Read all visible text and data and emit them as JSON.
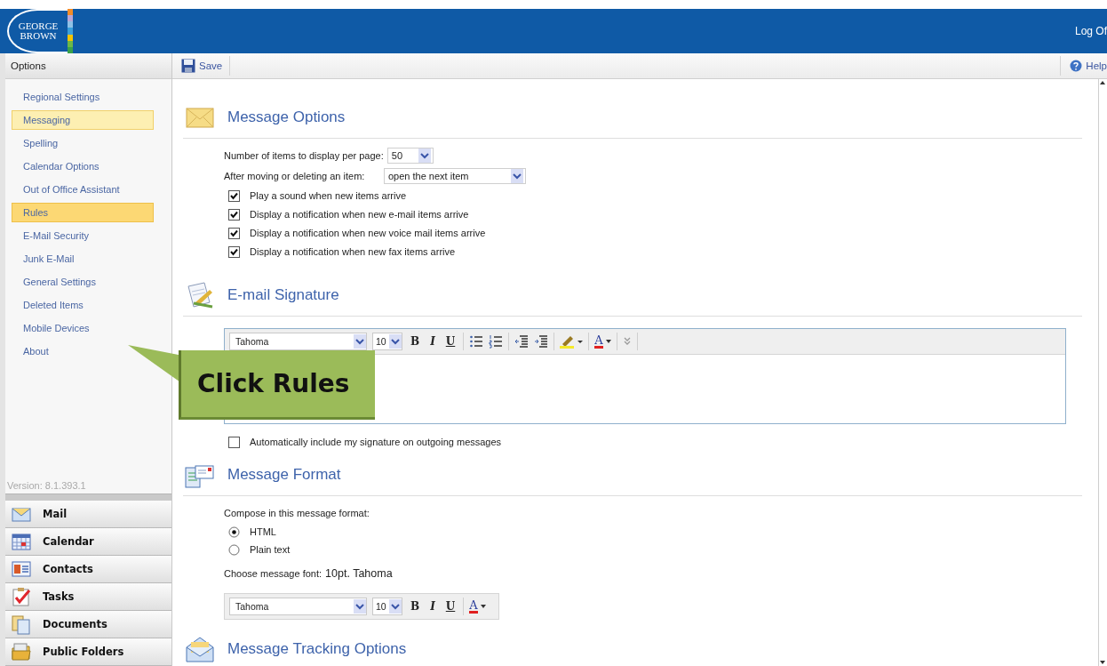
{
  "header": {
    "logo": [
      "GEORGE",
      "BROWN"
    ],
    "logoff": "Log Of"
  },
  "sidebar": {
    "title": "Options",
    "items": [
      {
        "label": "Regional Settings",
        "selected": false,
        "hovered": false
      },
      {
        "label": "Messaging",
        "selected": true,
        "hovered": false
      },
      {
        "label": "Spelling",
        "selected": false,
        "hovered": false
      },
      {
        "label": "Calendar Options",
        "selected": false,
        "hovered": false
      },
      {
        "label": "Out of Office Assistant",
        "selected": false,
        "hovered": false
      },
      {
        "label": "Rules",
        "selected": false,
        "hovered": true
      },
      {
        "label": "E-Mail Security",
        "selected": false,
        "hovered": false
      },
      {
        "label": "Junk E-Mail",
        "selected": false,
        "hovered": false
      },
      {
        "label": "General Settings",
        "selected": false,
        "hovered": false
      },
      {
        "label": "Deleted Items",
        "selected": false,
        "hovered": false
      },
      {
        "label": "Mobile Devices",
        "selected": false,
        "hovered": false
      },
      {
        "label": "About",
        "selected": false,
        "hovered": false
      }
    ],
    "version": "Version: 8.1.393.1",
    "nav": [
      {
        "label": "Mail",
        "kind": "mail"
      },
      {
        "label": "Calendar",
        "kind": "calendar"
      },
      {
        "label": "Contacts",
        "kind": "contacts"
      },
      {
        "label": "Tasks",
        "kind": "tasks"
      },
      {
        "label": "Documents",
        "kind": "documents"
      },
      {
        "label": "Public Folders",
        "kind": "folders"
      }
    ]
  },
  "toolbar": {
    "save": "Save",
    "help": "Help"
  },
  "message_options": {
    "title": "Message Options",
    "items_per_page": {
      "label": "Number of items to display per page:",
      "value": "50"
    },
    "after_moving": {
      "label": "After moving or deleting an item:",
      "value": "open the next item"
    },
    "checkboxes": [
      {
        "label": "Play a sound when new items arrive",
        "checked": true
      },
      {
        "label": "Display a notification when new e-mail items arrive",
        "checked": true
      },
      {
        "label": "Display a notification when new voice mail items arrive",
        "checked": true
      },
      {
        "label": "Display a notification when new fax items arrive",
        "checked": true
      }
    ]
  },
  "signature": {
    "title": "E-mail Signature",
    "font": "Tahoma",
    "size": "10",
    "format_buttons": [
      "B",
      "I",
      "U"
    ],
    "color_button": "A",
    "auto_include": {
      "label": "Automatically include my signature on outgoing messages",
      "checked": false
    }
  },
  "message_format": {
    "title": "Message Format",
    "prompt": "Compose in this message format:",
    "options": [
      {
        "label": "HTML",
        "selected": true
      },
      {
        "label": "Plain text",
        "selected": false
      }
    ],
    "font_label": "Choose message font:",
    "font_value": "10pt. Tahoma",
    "font": "Tahoma",
    "size": "10",
    "format_buttons": [
      "B",
      "I",
      "U"
    ],
    "color_button": "A"
  },
  "tracking": {
    "title": "Message Tracking Options"
  },
  "callout": {
    "text": "Click Rules"
  }
}
